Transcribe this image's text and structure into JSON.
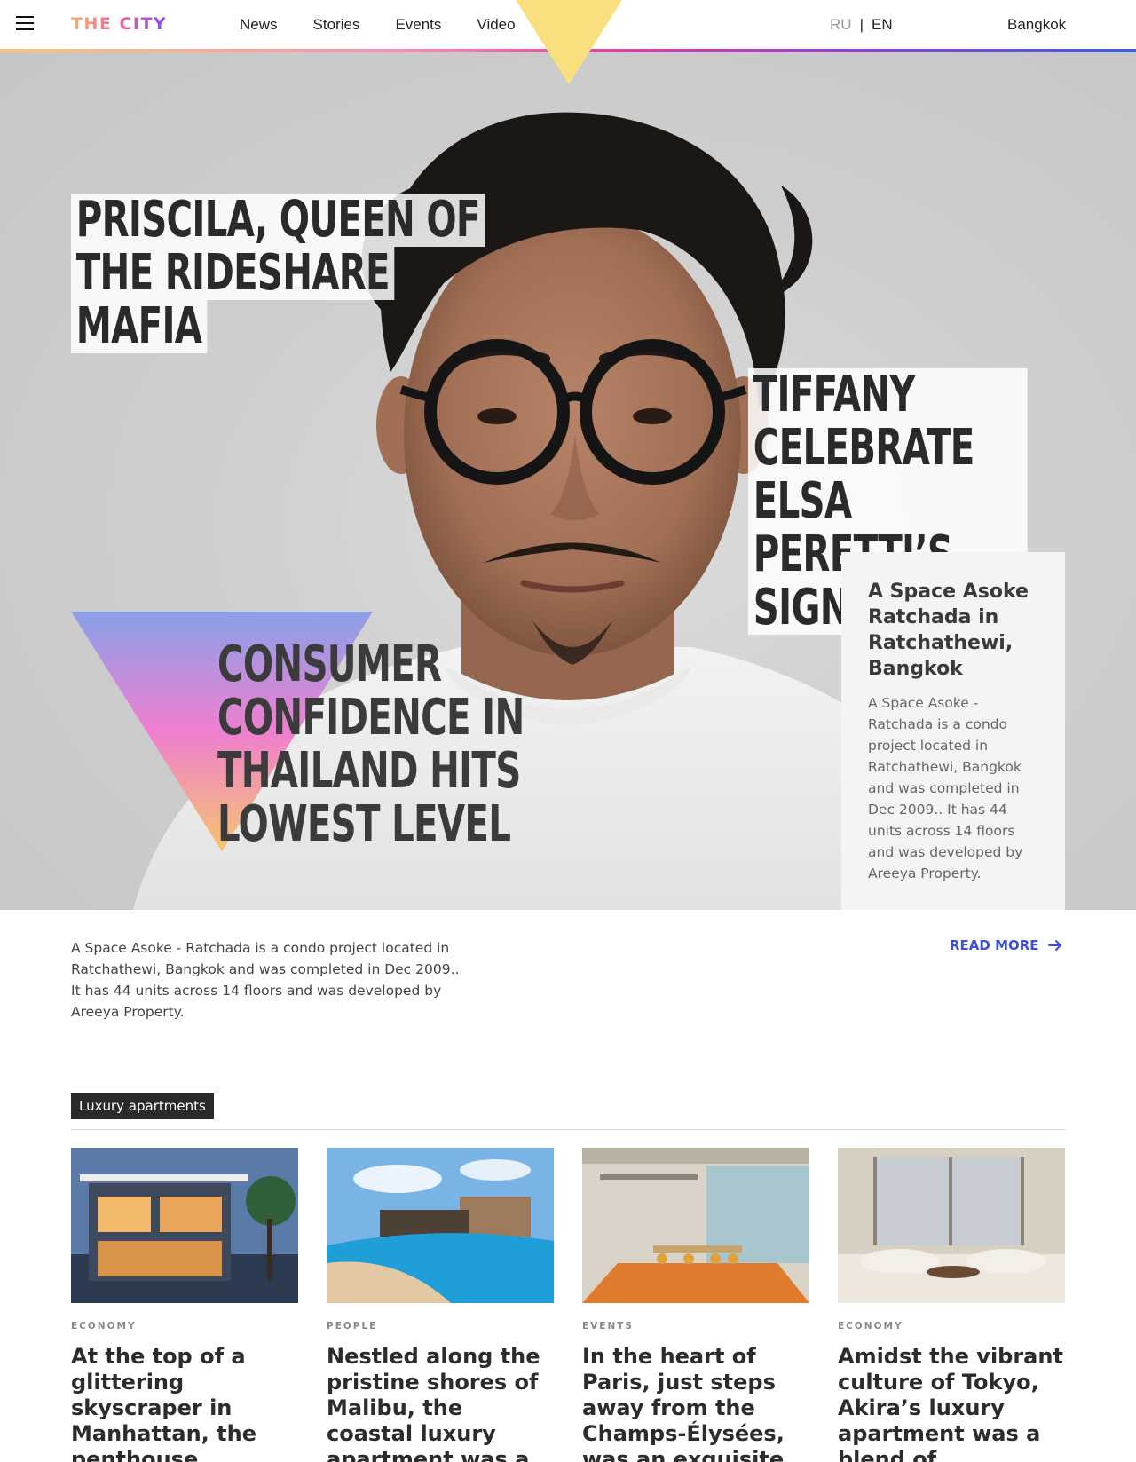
{
  "header": {
    "logo": "THE CITY",
    "nav": [
      "News",
      "Stories",
      "Events",
      "Video"
    ],
    "lang_ru": "RU",
    "lang_sep": "|",
    "lang_en": "EN",
    "city": "Bangkok"
  },
  "hero": {
    "headline_1": [
      "PRISCILA, QUEEN OF",
      "THE RIDESHARE",
      "MAFIA"
    ],
    "headline_2": [
      "TIFFANY CELEBRATE",
      "ELSA PERETTI’S",
      "SIGNS"
    ],
    "headline_3": [
      "CONSUMER",
      "CONFIDENCE IN",
      "THAILAND HITS",
      "LOWEST LEVEL"
    ],
    "card_title": "A Space Asoke Ratchada in Ratchathewi, Bangkok",
    "card_text": "A Space Asoke - Ratchada is a condo project located in Ratchathewi, Bangkok and was completed in Dec 2009.. It has 44 units across 14 floors and was developed by Areeya Property."
  },
  "intro": {
    "text": "A Space Asoke - Ratchada is a condo project located in Ratchathewi, Bangkok and was completed in Dec 2009.. It has 44 units across 14 floors and was developed by Areeya Property.",
    "read_more": "READ MORE"
  },
  "section": {
    "tag": "Luxury apartments",
    "articles": [
      {
        "category": "ECONOMY",
        "title": "At the top of a glittering skyscraper in Manhattan, the penthouse apartment was an oasis of"
      },
      {
        "category": "PEOPLE",
        "title": "Nestled along the pristine shores of Malibu, the coastal luxury apartment was a dream come"
      },
      {
        "category": "EVENTS",
        "title": "In the heart of Paris, just steps away from the Champs-Élysées, was an exquisite apartment that"
      },
      {
        "category": "ECONOMY",
        "title": "Amidst the vibrant culture of Tokyo, Akira’s luxury apartment was a blend of traditional"
      }
    ]
  },
  "colors": {
    "accent": "#3b4fd8",
    "top_triangle": "#f9df7e",
    "tag_bg": "#2a2a2a"
  },
  "icons": {
    "menu": "hamburger-icon",
    "read_more": "arrow-right-icon"
  }
}
